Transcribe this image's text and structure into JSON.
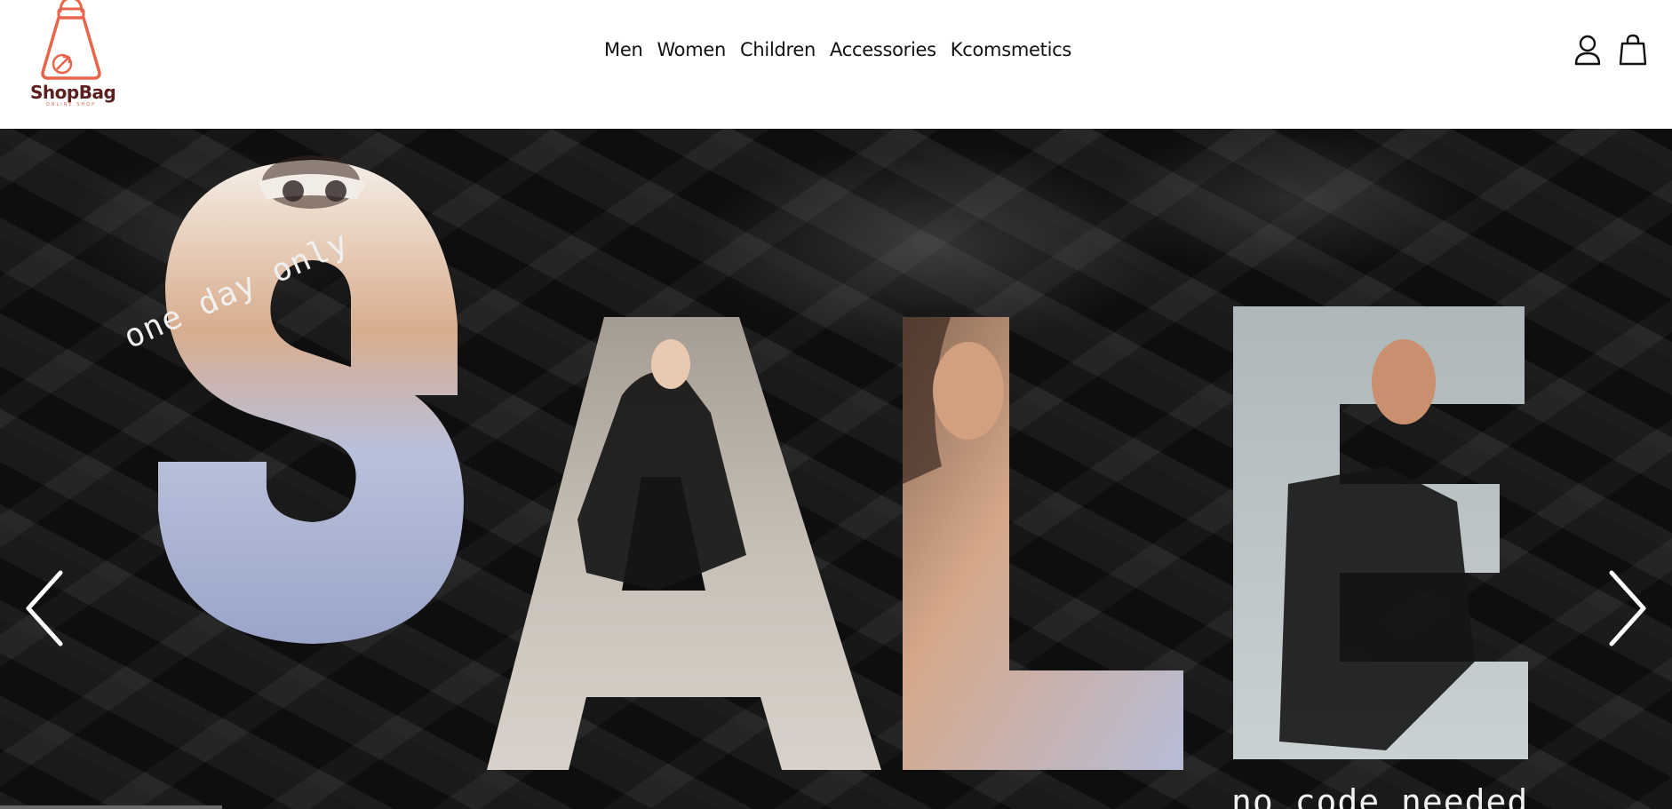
{
  "brand": {
    "name": "ShopBag",
    "tagline": "ONLINE SHOP",
    "logo_color": "#e8654b",
    "name_color": "#5b1f1f"
  },
  "nav": {
    "items": [
      {
        "label": "Men"
      },
      {
        "label": "Women"
      },
      {
        "label": "Children"
      },
      {
        "label": "Accessories"
      },
      {
        "label": "Kcomsmetics"
      }
    ]
  },
  "header_icons": {
    "account": "user-icon",
    "cart": "shopping-bag-icon"
  },
  "hero": {
    "headline": "SALE",
    "tagline_top": "one day only",
    "tagline_bottom": "no code needed",
    "prev_icon": "chevron-left-icon",
    "next_icon": "chevron-right-icon",
    "background_color": "#141414"
  }
}
